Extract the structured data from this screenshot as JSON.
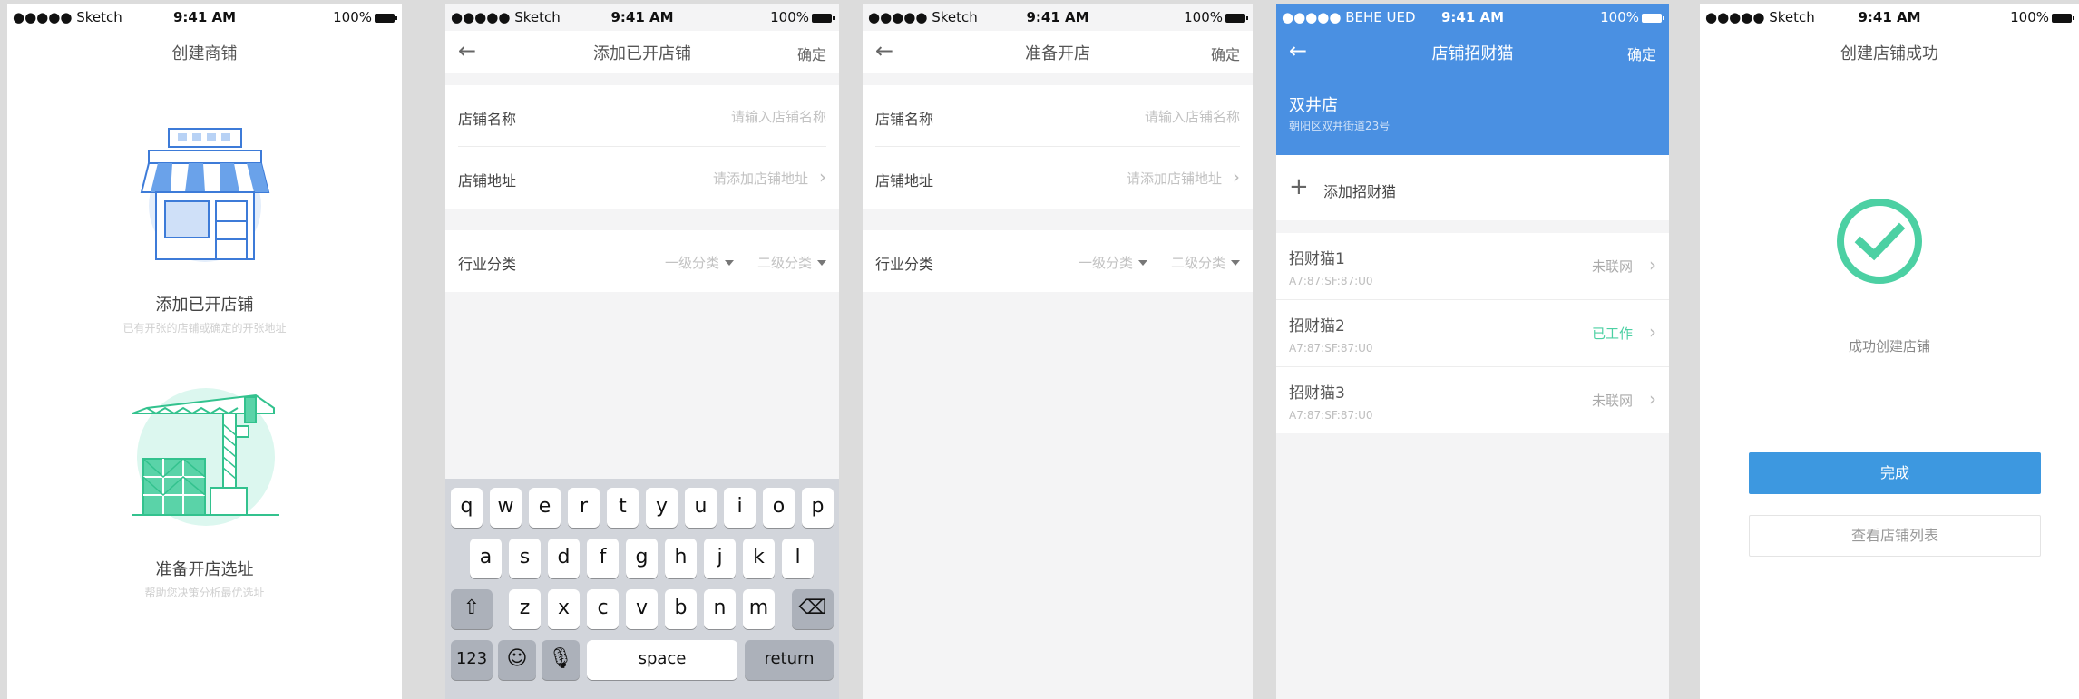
{
  "colors": {
    "accent_blue": "#4a90e2",
    "success_green": "#4cd0a3",
    "button_blue": "#3d98e0"
  },
  "status": {
    "carrier": "●●●●● Sketch",
    "carrier_alt": "●●●●● BEHE UED",
    "time": "9:41 AM",
    "battery": "100%"
  },
  "screen1": {
    "title": "创建商铺",
    "option1": {
      "label": "添加已开店铺",
      "sub": "已有开张的店铺或确定的开张地址",
      "icon": "storefront-icon"
    },
    "option2": {
      "label": "准备开店选址",
      "sub": "帮助您决策分析最优选址",
      "icon": "construction-crane-icon"
    }
  },
  "screen2": {
    "title": "添加已开店铺",
    "confirm": "确定",
    "name_label": "店铺名称",
    "name_placeholder": "请输入店铺名称",
    "addr_label": "店铺地址",
    "addr_placeholder": "请添加店铺地址",
    "cat_label": "行业分类",
    "cat1": "一级分类",
    "cat2": "二级分类",
    "keyboard": {
      "row1": [
        "q",
        "w",
        "e",
        "r",
        "t",
        "y",
        "u",
        "i",
        "o",
        "p"
      ],
      "row2": [
        "a",
        "s",
        "d",
        "f",
        "g",
        "h",
        "j",
        "k",
        "l"
      ],
      "row3": [
        "z",
        "x",
        "c",
        "v",
        "b",
        "n",
        "m"
      ],
      "num": "123",
      "space": "space",
      "return": "return"
    }
  },
  "screen3": {
    "title": "准备开店",
    "confirm": "确定",
    "name_label": "店铺名称",
    "name_placeholder": "请输入店铺名称",
    "addr_label": "店铺地址",
    "addr_placeholder": "请添加店铺地址",
    "cat_label": "行业分类",
    "cat1": "一级分类",
    "cat2": "二级分类"
  },
  "screen4": {
    "title": "店铺招财猫",
    "confirm": "确定",
    "shop_name": "双井店",
    "shop_addr": "朝阳区双井街道23号",
    "add_label": "添加招财猫",
    "cats": [
      {
        "name": "招财猫1",
        "mac": "A7:87:SF:87:U0",
        "status": "未联网",
        "ok": false
      },
      {
        "name": "招财猫2",
        "mac": "A7:87:SF:87:U0",
        "status": "已工作",
        "ok": true
      },
      {
        "name": "招财猫3",
        "mac": "A7:87:SF:87:U0",
        "status": "未联网",
        "ok": false
      }
    ]
  },
  "screen5": {
    "title": "创建店铺成功",
    "message": "成功创建店铺",
    "done": "完成",
    "view_list": "查看店铺列表"
  }
}
